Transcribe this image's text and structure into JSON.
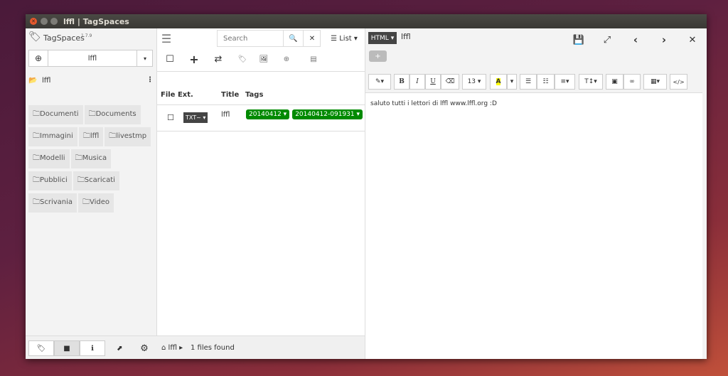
{
  "window": {
    "title": "lffl | TagSpaces"
  },
  "app": {
    "name": "TagSpaces",
    "version": "1.7.9"
  },
  "location": {
    "selected": "lffl"
  },
  "tree": {
    "root": "lffl",
    "folders": [
      "Documenti",
      "Documents",
      "Immagini",
      "lffl",
      "livestmp",
      "Modelli",
      "Musica",
      "Pubblici",
      "Scaricati",
      "Scrivania",
      "Video"
    ]
  },
  "search": {
    "placeholder": "Search"
  },
  "view": {
    "label": "List"
  },
  "table": {
    "headers": {
      "ext": "File Ext.",
      "title": "Title",
      "tags": "Tags"
    },
    "rows": [
      {
        "ext": "TXT~",
        "title": "lffl",
        "tags": [
          "20140412",
          "20140412-091931"
        ]
      }
    ]
  },
  "status": {
    "path": "lffl",
    "count": "1 files found"
  },
  "editor": {
    "mode": "HTML",
    "filename": "lffl",
    "font_size": "13",
    "content": "saluto tutti i lettori di lffl www.lffl.org :D"
  },
  "colors": {
    "tag": "#008a00"
  }
}
